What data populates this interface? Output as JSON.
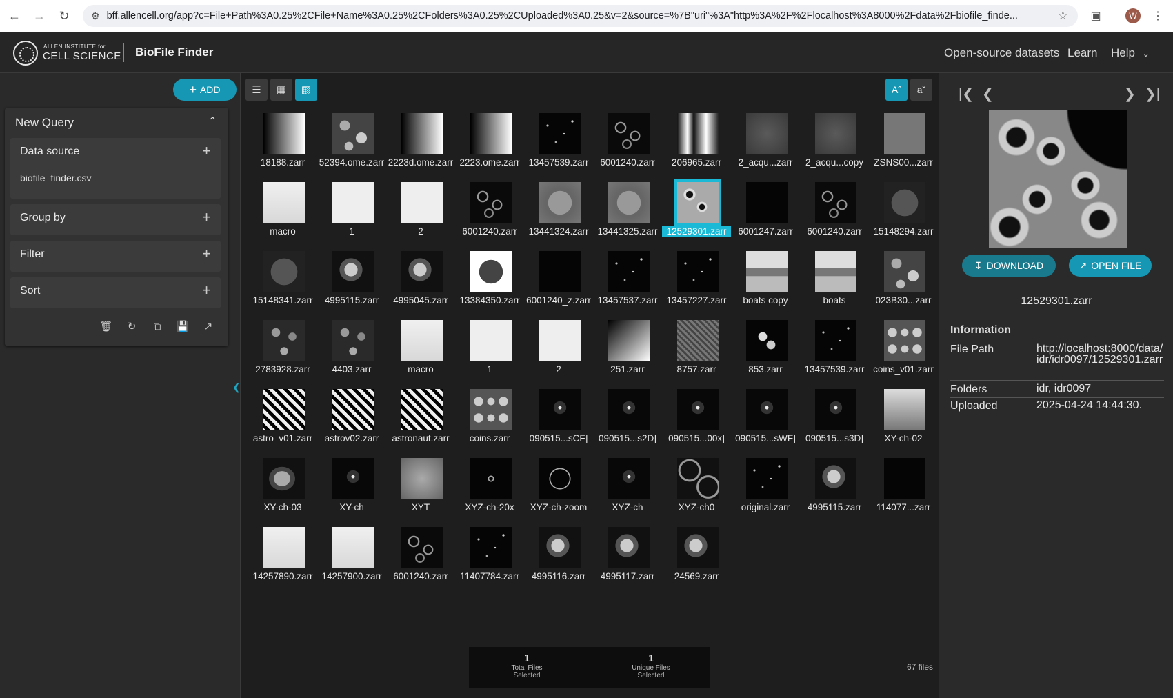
{
  "browser": {
    "url": "bff.allencell.org/app?c=File+Path%3A0.25%2CFile+Name%3A0.25%2CFolders%3A0.25%2CUploaded%3A0.25&v=2&source=%7B\"uri\"%3A\"http%3A%2F%2Flocalhost%3A8000%2Fdata%2Fbiofile_finde...",
    "profile_initial": "W"
  },
  "header": {
    "org_line1": "ALLEN INSTITUTE for",
    "org_line2": "CELL SCIENCE",
    "app_title": "BioFile Finder",
    "links": [
      "Open-source datasets",
      "Learn",
      "Help"
    ]
  },
  "left": {
    "add_label": "ADD",
    "query_title": "New Query",
    "sections": {
      "data_source": "Data source",
      "data_source_value": "biofile_finder.csv",
      "group_by": "Group by",
      "filter": "Filter",
      "sort": "Sort"
    }
  },
  "files": [
    {
      "name": "18188.zarr",
      "thumb": "t-gradient-r"
    },
    {
      "name": "52394.ome.zarr",
      "thumb": "t-noise"
    },
    {
      "name": "2223d.ome.zarr",
      "thumb": "t-gradient"
    },
    {
      "name": "2223.ome.zarr",
      "thumb": "t-gradient"
    },
    {
      "name": "13457539.zarr",
      "thumb": "t-dark-dots"
    },
    {
      "name": "6001240.zarr",
      "thumb": "t-cells"
    },
    {
      "name": "206965.zarr",
      "thumb": "t-bars"
    },
    {
      "name": "2_acqu...zarr",
      "thumb": "t-grayish"
    },
    {
      "name": "2_acqu...copy",
      "thumb": "t-grayish"
    },
    {
      "name": "ZSNS00...zarr",
      "thumb": "t-zsn"
    },
    {
      "name": "macro",
      "thumb": "t-white-doc"
    },
    {
      "name": "1",
      "thumb": "t-slide"
    },
    {
      "name": "2",
      "thumb": "t-slide"
    },
    {
      "name": "6001240.zarr",
      "thumb": "t-cells"
    },
    {
      "name": "13441324.zarr",
      "thumb": "t-dic"
    },
    {
      "name": "13441325.zarr",
      "thumb": "t-dic"
    },
    {
      "name": "12529301.zarr",
      "thumb": "t-cyan-cells",
      "selected": true
    },
    {
      "name": "6001247.zarr",
      "thumb": "t-black"
    },
    {
      "name": "6001240.zarr",
      "thumb": "t-cells"
    },
    {
      "name": "15148294.zarr",
      "thumb": "t-circle-tissue"
    },
    {
      "name": "15148341.zarr",
      "thumb": "t-circle-tissue"
    },
    {
      "name": "4995115.zarr",
      "thumb": "t-fluor"
    },
    {
      "name": "4995045.zarr",
      "thumb": "t-fluor"
    },
    {
      "name": "13384350.zarr",
      "thumb": "t-round-white"
    },
    {
      "name": "6001240_z.zarr",
      "thumb": "t-black"
    },
    {
      "name": "13457537.zarr",
      "thumb": "t-dark-dots"
    },
    {
      "name": "13457227.zarr",
      "thumb": "t-dark-dots"
    },
    {
      "name": "boats copy",
      "thumb": "t-boats"
    },
    {
      "name": "boats",
      "thumb": "t-boats"
    },
    {
      "name": "023B30...zarr",
      "thumb": "t-noise"
    },
    {
      "name": "2783928.zarr",
      "thumb": "t-nuclei"
    },
    {
      "name": "4403.zarr",
      "thumb": "t-nuclei"
    },
    {
      "name": "macro",
      "thumb": "t-white-doc"
    },
    {
      "name": "1",
      "thumb": "t-slide"
    },
    {
      "name": "2",
      "thumb": "t-slide"
    },
    {
      "name": "251.zarr",
      "thumb": "t-grad251"
    },
    {
      "name": "8757.zarr",
      "thumb": "t-fiber"
    },
    {
      "name": "853.zarr",
      "thumb": "t-twospot"
    },
    {
      "name": "13457539.zarr",
      "thumb": "t-dark-dots"
    },
    {
      "name": "coins_v01.zarr",
      "thumb": "t-coins"
    },
    {
      "name": "astro_v01.zarr",
      "thumb": "t-astro"
    },
    {
      "name": "astrov02.zarr",
      "thumb": "t-astro"
    },
    {
      "name": "astronaut.zarr",
      "thumb": "t-astro"
    },
    {
      "name": "coins.zarr",
      "thumb": "t-coins"
    },
    {
      "name": "090515...sCF]",
      "thumb": "t-spot"
    },
    {
      "name": "090515...s2D]",
      "thumb": "t-spot"
    },
    {
      "name": "090515...00x]",
      "thumb": "t-spot"
    },
    {
      "name": "090515...sWF]",
      "thumb": "t-spot"
    },
    {
      "name": "090515...s3D]",
      "thumb": "t-spot"
    },
    {
      "name": "XY-ch-02",
      "thumb": "t-xych02"
    },
    {
      "name": "XY-ch-03",
      "thumb": "t-wormcells"
    },
    {
      "name": "XY-ch",
      "thumb": "t-spot"
    },
    {
      "name": "XYT",
      "thumb": "t-xyt"
    },
    {
      "name": "XYZ-ch-20x",
      "thumb": "t-small-ring"
    },
    {
      "name": "XYZ-ch-zoom",
      "thumb": "t-ring",
      "wrap": true
    },
    {
      "name": "XYZ-ch",
      "thumb": "t-spot"
    },
    {
      "name": "XYZ-ch0",
      "thumb": "t-mesh"
    },
    {
      "name": "original.zarr",
      "thumb": "t-dark-dots"
    },
    {
      "name": "4995115.zarr",
      "thumb": "t-fluor"
    },
    {
      "name": "114077...zarr",
      "thumb": "t-black"
    },
    {
      "name": "14257890.zarr",
      "thumb": "t-white-doc"
    },
    {
      "name": "14257900.zarr",
      "thumb": "t-white-doc"
    },
    {
      "name": "6001240.zarr",
      "thumb": "t-cells"
    },
    {
      "name": "11407784.zarr",
      "thumb": "t-dark-dots"
    },
    {
      "name": "4995116.zarr",
      "thumb": "t-fluor"
    },
    {
      "name": "4995117.zarr",
      "thumb": "t-fluor"
    },
    {
      "name": "24569.zarr",
      "thumb": "t-fluor"
    }
  ],
  "selection": {
    "total_num": "1",
    "total_line1": "Total Files",
    "total_line2": "Selected",
    "unique_num": "1",
    "unique_line1": "Unique Files",
    "unique_line2": "Selected",
    "file_count": "67 files"
  },
  "details": {
    "download_label": "DOWNLOAD",
    "open_label": "OPEN FILE",
    "filename": "12529301.zarr",
    "info_title": "Information",
    "rows": [
      {
        "key": "File Path",
        "value": "http://localhost:8000/data/idr/idr0097/12529301.zarr"
      },
      {
        "key": "Folders",
        "value": "idr, idr0097"
      },
      {
        "key": "Uploaded",
        "value": "2025-04-24 14:44:30."
      }
    ]
  },
  "colors": {
    "accent": "#1697b3",
    "selected": "#1ab9d6",
    "background": "#1e1e1e"
  }
}
